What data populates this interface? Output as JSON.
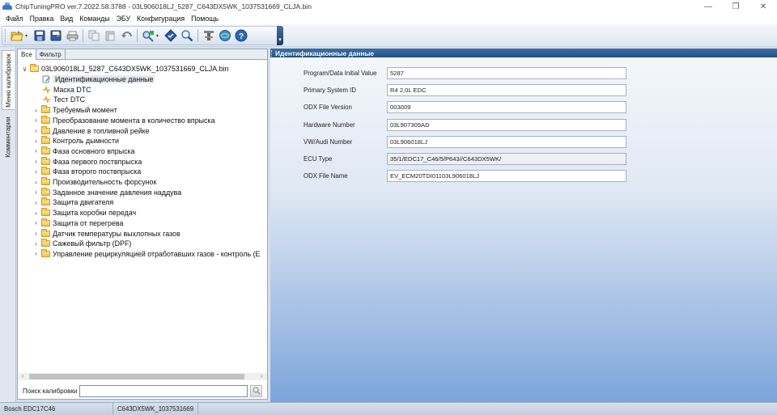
{
  "window": {
    "title": "ChipTuningPRO ver.7.2022.58.3788 - 03L906018LJ_5287_C643DX5WK_1037531669_CLJA.bin",
    "controls": [
      "—",
      "❐",
      "✕"
    ]
  },
  "menu": [
    "Файл",
    "Правка",
    "Вид",
    "Команды",
    "ЭБУ",
    "Конфигурация",
    "Помощь"
  ],
  "toolbar": {
    "buttons": [
      "open-icon",
      "save-icon",
      "save-as-icon",
      "print-icon",
      "copy-icon",
      "paste-icon",
      "undo-icon",
      "ecu-identify-icon",
      "checksum-icon",
      "search-icon",
      "tools-icon",
      "update-icon",
      "help-icon"
    ]
  },
  "side_tabs": [
    "Меню калибровок",
    "Комментарии"
  ],
  "tree_tabs": [
    "Все",
    "Фильтр"
  ],
  "tree": {
    "root": "03L906018LJ_5287_C643DX5WK_1037531669_CLJA.bin",
    "leaves": [
      "Идентификационные данные",
      "Маска DTC",
      "Тест DTC"
    ],
    "folders": [
      "Требуемый момент",
      "Преобразование момента в количество впрыска",
      "Давление в топливной рейке",
      "Контроль дымности",
      "Фаза основного впрыска",
      "Фаза первого поствпрыска",
      "Фаза второго поствпрыска",
      "Производительность форсунок",
      "Заданное значение давления наддува",
      "Защита двигателя",
      "Защита коробки передач",
      "Защита от перегрева",
      "Датчик температуры выхлопных газов",
      "Сажевый фильтр (DPF)",
      "Управление рециркуляцией отработавших газов - контроль (E"
    ]
  },
  "search": {
    "label": "Поиск калибровки",
    "value": ""
  },
  "details": {
    "header": "Идентификационные данные",
    "fields": [
      {
        "label": "Program/Data Initial Value",
        "value": "5287"
      },
      {
        "label": "Primary System ID",
        "value": "R4 2,0L EDC"
      },
      {
        "label": "ODX File Version",
        "value": "003009"
      },
      {
        "label": "Hardware Number",
        "value": "03L907309AD"
      },
      {
        "label": "VW/Audi Number",
        "value": "03L906018LJ"
      },
      {
        "label": "ECU Type",
        "value": "35/1/EDC17_C46/5/P643//C643DX5WK/"
      },
      {
        "label": "ODX File Name",
        "value": "EV_ECM20TDI01103L906018LJ"
      }
    ]
  },
  "status": {
    "ecu": "Bosch EDC17C46",
    "sw": "C643DX5WK_1037531669"
  }
}
